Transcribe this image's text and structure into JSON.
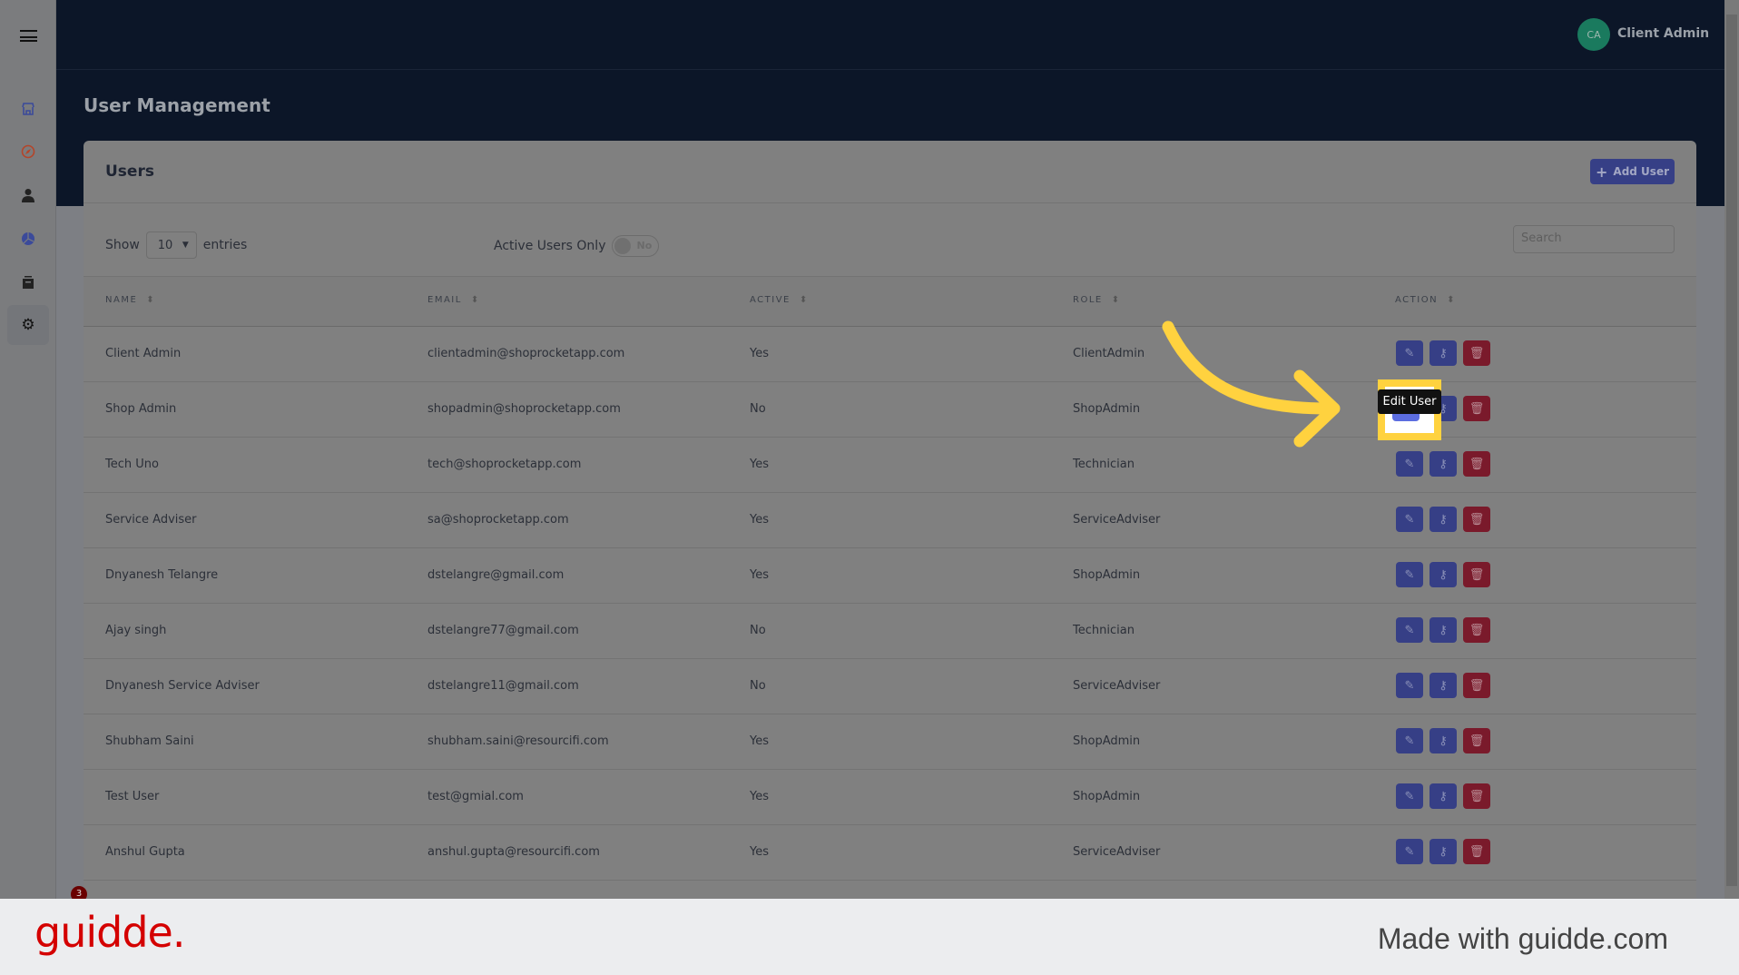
{
  "header": {
    "avatar_initials": "CA",
    "user_name": "Client Admin"
  },
  "page_title": "User Management",
  "sidebar": {
    "items": [
      {
        "icon": "store-icon",
        "color": "#3b4a9a"
      },
      {
        "icon": "compass-icon",
        "color": "#b4452a"
      },
      {
        "icon": "user-icon",
        "color": "#222"
      },
      {
        "icon": "pie-chart-icon",
        "color": "#3b4a9a"
      },
      {
        "icon": "archive-icon",
        "color": "#222"
      },
      {
        "icon": "gear-icon",
        "color": "#111"
      }
    ]
  },
  "card": {
    "title": "Users",
    "add_button": "Add User"
  },
  "controls": {
    "show_label": "Show",
    "entries_value": "10",
    "entries_label": "entries",
    "active_only_label": "Active Users Only",
    "toggle_value": "No",
    "search_placeholder": "Search"
  },
  "table": {
    "headers": [
      "NAME",
      "EMAIL",
      "ACTIVE",
      "ROLE",
      "ACTION"
    ],
    "rows": [
      {
        "name": "Client Admin",
        "email": "clientadmin@shoprocketapp.com",
        "active": "Yes",
        "role": "ClientAdmin"
      },
      {
        "name": "Shop Admin",
        "email": "shopadmin@shoprocketapp.com",
        "active": "No",
        "role": "ShopAdmin"
      },
      {
        "name": "Tech Uno",
        "email": "tech@shoprocketapp.com",
        "active": "Yes",
        "role": "Technician"
      },
      {
        "name": "Service Adviser",
        "email": "sa@shoprocketapp.com",
        "active": "Yes",
        "role": "ServiceAdviser"
      },
      {
        "name": "Dnyanesh Telangre",
        "email": "dstelangre@gmail.com",
        "active": "Yes",
        "role": "ShopAdmin"
      },
      {
        "name": "Ajay singh",
        "email": "dstelangre77@gmail.com",
        "active": "No",
        "role": "Technician"
      },
      {
        "name": "Dnyanesh Service Adviser",
        "email": "dstelangre11@gmail.com",
        "active": "No",
        "role": "ServiceAdviser"
      },
      {
        "name": "Shubham Saini",
        "email": "shubham.saini@resourcifi.com",
        "active": "Yes",
        "role": "ShopAdmin"
      },
      {
        "name": "Test User",
        "email": "test@gmial.com",
        "active": "Yes",
        "role": "ShopAdmin"
      },
      {
        "name": "Anshul Gupta",
        "email": "anshul.gupta@resourcifi.com",
        "active": "Yes",
        "role": "ServiceAdviser"
      }
    ]
  },
  "tooltip": "Edit User",
  "notification_count": "3",
  "footer": {
    "logo": "guidde.",
    "made_with": "Made with guidde.com"
  },
  "colors": {
    "primary": "#363f86",
    "danger": "#7a1a2b",
    "highlight": "#ffd23f",
    "navy": "#0c1628"
  }
}
